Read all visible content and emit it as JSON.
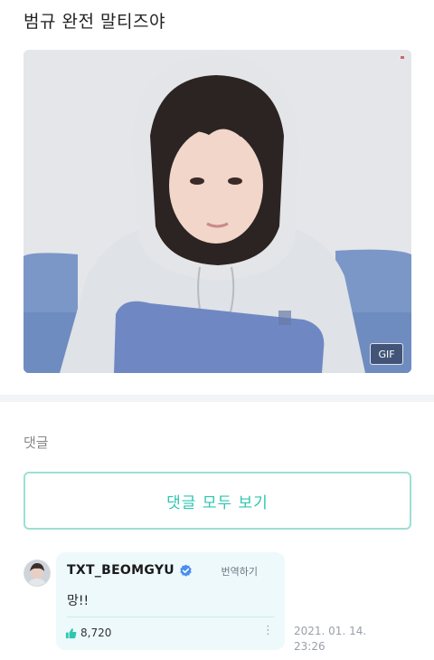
{
  "post": {
    "title": "범규 완전 말티즈야",
    "gif_badge": "GIF"
  },
  "comments": {
    "heading": "댓글",
    "view_all_label": "댓글 모두 보기",
    "items": [
      {
        "author": "TXT_BEOMGYU",
        "verified": true,
        "translate_label": "번역하기",
        "text": "망!!",
        "likes": "8,720",
        "date": "2021. 01. 14.",
        "time": "23:26"
      }
    ]
  },
  "colors": {
    "accent": "#2fc6b0",
    "accent_border": "#9ddfd4",
    "bubble_bg": "#eef9fb",
    "verified": "#4a8ef0"
  }
}
